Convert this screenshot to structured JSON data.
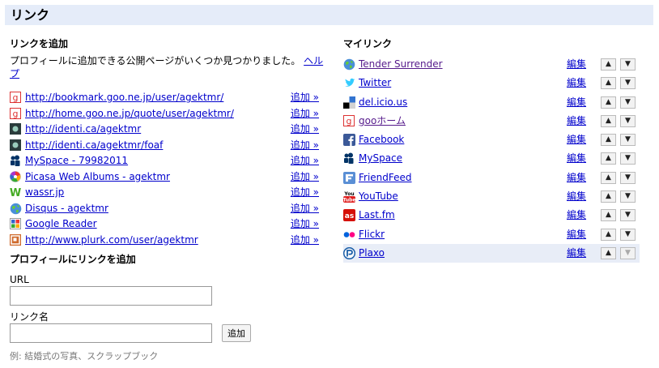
{
  "page_title": "リンク",
  "add_links": {
    "heading": "リンクを追加",
    "description": "プロフィールに追加できる公開ページがいくつか見つかりました。",
    "help_label": "ヘルプ",
    "add_label": "追加 »",
    "suggestions": [
      {
        "text": "http://bookmark.goo.ne.jp/user/agektmr/",
        "icon": "goo-icon"
      },
      {
        "text": "http://home.goo.ne.jp/quote/user/agektmr/",
        "icon": "goo-icon"
      },
      {
        "text": "http://identi.ca/agektmr",
        "icon": "identica-icon"
      },
      {
        "text": "http://identi.ca/agektmr/foaf",
        "icon": "identica-icon"
      },
      {
        "text": "MySpace - 79982011",
        "icon": "myspace-icon"
      },
      {
        "text": "Picasa Web Albums - agektmr",
        "icon": "picasa-icon"
      },
      {
        "text": "wassr.jp",
        "icon": "wassr-icon"
      },
      {
        "text": "Disqus - agektmr",
        "icon": "globe-icon"
      },
      {
        "text": "Google Reader",
        "icon": "reader-icon"
      },
      {
        "text": "http://www.plurk.com/user/agektmr",
        "icon": "plurk-icon"
      }
    ]
  },
  "add_form": {
    "heading": "プロフィールにリンクを追加",
    "url_label": "URL",
    "url_value": "",
    "name_label": "リンク名",
    "name_value": "",
    "submit_label": "追加",
    "hint": "例: 結婚式の写真、スクラップブック"
  },
  "my_links": {
    "heading": "マイリンク",
    "edit_label": "編集",
    "up_glyph": "▲",
    "down_glyph": "▼",
    "items": [
      {
        "text": "Tender Surrender",
        "icon": "globe-icon",
        "visited": true
      },
      {
        "text": "Twitter",
        "icon": "twitter-icon",
        "visited": false
      },
      {
        "text": "del.icio.us",
        "icon": "delicious-icon",
        "visited": false
      },
      {
        "text": "gooホーム",
        "icon": "goo-icon",
        "visited": true
      },
      {
        "text": "Facebook",
        "icon": "facebook-icon",
        "visited": false
      },
      {
        "text": "MySpace",
        "icon": "myspace-icon",
        "visited": false
      },
      {
        "text": "FriendFeed",
        "icon": "friendfeed-icon",
        "visited": false
      },
      {
        "text": "YouTube",
        "icon": "youtube-icon",
        "visited": false
      },
      {
        "text": "Last.fm",
        "icon": "lastfm-icon",
        "visited": false
      },
      {
        "text": "Flickr",
        "icon": "flickr-icon",
        "visited": false
      },
      {
        "text": "Plaxo",
        "icon": "plaxo-icon",
        "visited": false,
        "highlighted": true
      }
    ]
  },
  "colors": {
    "header_bg": "#e5ecf9",
    "link": "#0000cc",
    "visited": "#551a8b",
    "highlight_row": "#e8edf7"
  }
}
